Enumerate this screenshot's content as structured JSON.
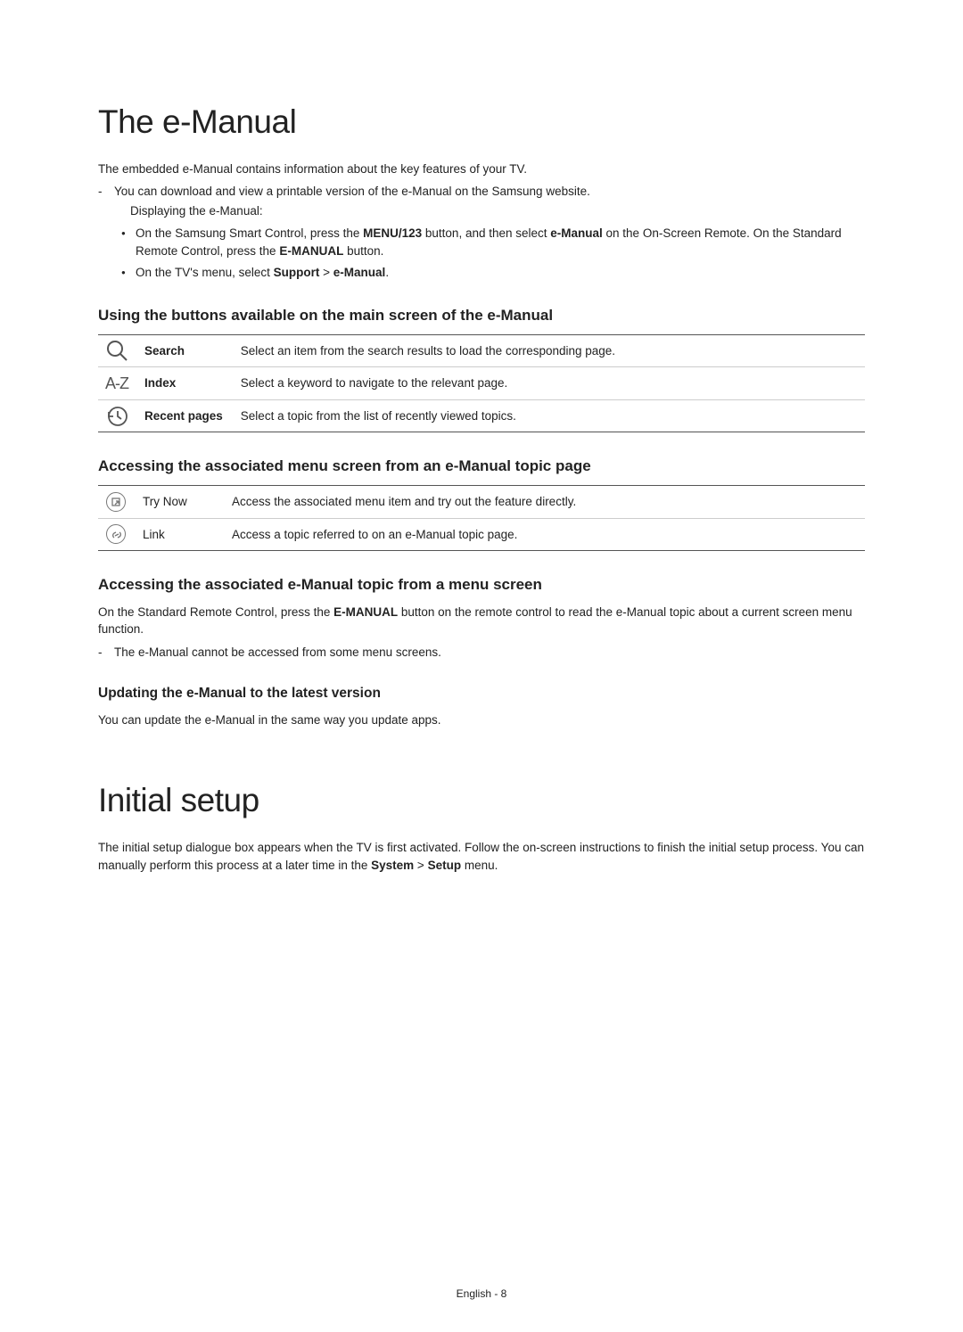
{
  "section1": {
    "title": "The e-Manual",
    "intro": "The embedded e-Manual contains information about the key features of your TV.",
    "dash_items": [
      {
        "text": "You can download and view a printable version of the e-Manual on the Samsung website.",
        "sub": "Displaying the e-Manual:"
      }
    ],
    "bullets": [
      {
        "pre": "On the Samsung Smart Control, press the ",
        "b1": "MENU/123",
        "mid1": " button, and then select ",
        "b2": "e-Manual",
        "mid2": " on the On-Screen Remote. On the Standard Remote Control, press the ",
        "b3": "E-MANUAL",
        "post": " button."
      },
      {
        "pre": "On the TV's menu, select ",
        "b1": "Support",
        "mid1": " > ",
        "b2": "e-Manual",
        "post": "."
      }
    ],
    "h2a": "Using the buttons available on the main screen of the e-Manual",
    "tableA": {
      "rows": [
        {
          "label": "Search",
          "desc": "Select an item from the search results to load the corresponding page."
        },
        {
          "label": "Index",
          "desc": "Select a keyword to navigate to the relevant page."
        },
        {
          "label": "Recent pages",
          "desc": "Select a topic from the list of recently viewed topics."
        }
      ]
    },
    "h2b": "Accessing the associated menu screen from an e-Manual topic page",
    "tableB": {
      "rows": [
        {
          "label": "Try Now",
          "desc": "Access the associated menu item and try out the feature directly."
        },
        {
          "label": "Link",
          "desc": "Access a topic referred to on an e-Manual topic page."
        }
      ]
    },
    "h2c": "Accessing the associated e-Manual topic from a menu screen",
    "para_c": {
      "pre": "On the Standard Remote Control, press the ",
      "b1": "E-MANUAL",
      "post": " button on the remote control to read the e-Manual topic about a current screen menu function."
    },
    "dash_c": [
      "The e-Manual cannot be accessed from some menu screens."
    ],
    "h2d": "Updating the e-Manual to the latest version",
    "para_d": "You can update the e-Manual in the same way you update apps."
  },
  "section2": {
    "title": "Initial setup",
    "para": {
      "pre": "The initial setup dialogue box appears when the TV is first activated. Follow the on-screen instructions to finish the initial setup process. You can manually perform this process at a later time in the ",
      "b1": "System",
      "mid": " > ",
      "b2": "Setup",
      "post": " menu."
    }
  },
  "footer": "English - 8",
  "icons": {
    "search": "search-icon",
    "index": "index-icon",
    "recent": "recent-pages-icon",
    "trynow": "try-now-icon",
    "link": "link-icon"
  }
}
